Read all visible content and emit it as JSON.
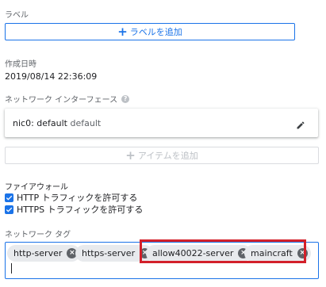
{
  "labels": {
    "heading": "ラベル",
    "add_label_button": "ラベルを追加"
  },
  "created": {
    "heading": "作成日時",
    "value": "2019/08/14 22:36:09"
  },
  "network_interfaces": {
    "heading": "ネットワーク インターフェース",
    "help_icon": "help-icon",
    "nic": {
      "name": "nic0: default",
      "subnet": "default"
    },
    "add_item_button": "アイテムを追加"
  },
  "firewall": {
    "heading": "ファイアウォール",
    "options": [
      {
        "label": "HTTP トラフィックを許可する",
        "checked": true
      },
      {
        "label": "HTTPS トラフィックを許可する",
        "checked": true
      }
    ]
  },
  "network_tags": {
    "heading": "ネットワーク タグ",
    "tags": [
      "http-server",
      "https-server",
      "allow40022-server",
      "maincraft"
    ]
  },
  "colors": {
    "accent": "#1a73e8",
    "highlight": "#d3202a",
    "chip": "#e8eaed"
  }
}
